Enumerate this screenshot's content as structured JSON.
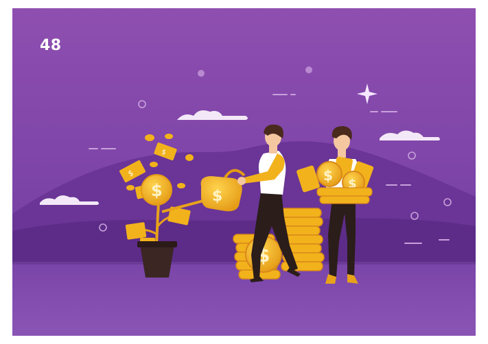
{
  "page": {
    "number": "48"
  },
  "illustration": {
    "currency_symbol": "$",
    "colors": {
      "sky_top": "#8e4fb0",
      "sky_bottom": "#6e3aa0",
      "hill_far": "#6a3596",
      "hill_near": "#5d2c88",
      "ground": "#7a45a8",
      "gold": "#f2b21c",
      "gold_dark": "#d9891a",
      "shirt": "#ffffff",
      "pants": "#2b1d1a",
      "hair": "#4a2a1c",
      "skin": "#f4c7a1",
      "pot": "#3b2624",
      "cloud": "#f3e8f7"
    }
  }
}
